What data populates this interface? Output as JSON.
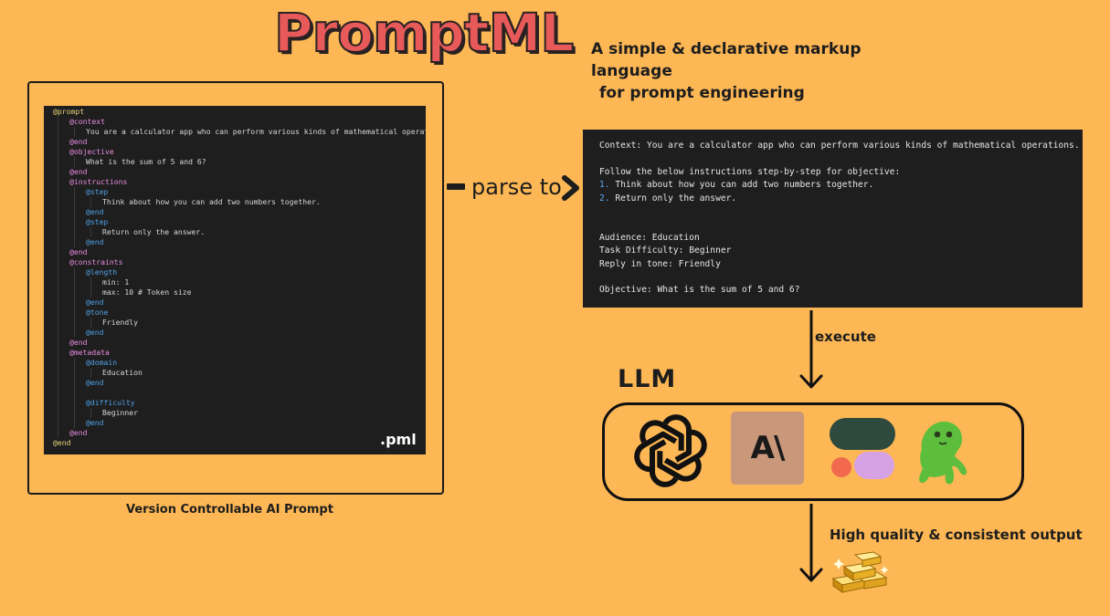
{
  "header": {
    "title": "PromptML",
    "subtitle_line1": "A simple & declarative  markup language",
    "subtitle_line2": "for prompt engineering"
  },
  "pml_panel": {
    "extension": ".pml",
    "caption": "Version Controllable AI Prompt",
    "code_lines": [
      {
        "depth": 0,
        "text": "@prompt",
        "kind": "k0"
      },
      {
        "depth": 1,
        "text": "@context",
        "kind": "k1"
      },
      {
        "depth": 2,
        "text": "You are a calculator app who can perform various kinds of mathematical operations.",
        "kind": "txt"
      },
      {
        "depth": 1,
        "text": "@end",
        "kind": "k1"
      },
      {
        "depth": 1,
        "text": "@objective",
        "kind": "k1"
      },
      {
        "depth": 2,
        "text": "What is the sum of 5 and 6?",
        "kind": "txt"
      },
      {
        "depth": 1,
        "text": "@end",
        "kind": "k1"
      },
      {
        "depth": 1,
        "text": "@instructions",
        "kind": "k1"
      },
      {
        "depth": 2,
        "text": "@step",
        "kind": "k2"
      },
      {
        "depth": 3,
        "text": "Think about how you can add two numbers together.",
        "kind": "txt"
      },
      {
        "depth": 2,
        "text": "@end",
        "kind": "k2"
      },
      {
        "depth": 2,
        "text": "@step",
        "kind": "k2"
      },
      {
        "depth": 3,
        "text": "Return only the answer.",
        "kind": "txt"
      },
      {
        "depth": 2,
        "text": "@end",
        "kind": "k2"
      },
      {
        "depth": 1,
        "text": "@end",
        "kind": "k1"
      },
      {
        "depth": 1,
        "text": "@constraints",
        "kind": "k1"
      },
      {
        "depth": 2,
        "text": "@length",
        "kind": "k2"
      },
      {
        "depth": 3,
        "text": "min: 1",
        "kind": "txt"
      },
      {
        "depth": 3,
        "text": "max: 10 # Token size",
        "kind": "txt"
      },
      {
        "depth": 2,
        "text": "@end",
        "kind": "k2"
      },
      {
        "depth": 2,
        "text": "@tone",
        "kind": "k2"
      },
      {
        "depth": 3,
        "text": "Friendly",
        "kind": "txt"
      },
      {
        "depth": 2,
        "text": "@end",
        "kind": "k2"
      },
      {
        "depth": 1,
        "text": "@end",
        "kind": "k1"
      },
      {
        "depth": 1,
        "text": "@metadata",
        "kind": "k1"
      },
      {
        "depth": 2,
        "text": "@domain",
        "kind": "k2"
      },
      {
        "depth": 3,
        "text": "Education",
        "kind": "txt"
      },
      {
        "depth": 2,
        "text": "@end",
        "kind": "k2"
      },
      {
        "depth": 2,
        "text": "",
        "kind": "txt"
      },
      {
        "depth": 2,
        "text": "@difficulty",
        "kind": "k2"
      },
      {
        "depth": 3,
        "text": "Beginner",
        "kind": "txt"
      },
      {
        "depth": 2,
        "text": "@end",
        "kind": "k2"
      },
      {
        "depth": 1,
        "text": "@end",
        "kind": "k1"
      },
      {
        "depth": 0,
        "text": "@end",
        "kind": "k0"
      }
    ]
  },
  "parse_arrow": {
    "label": "parse to"
  },
  "output_panel": {
    "lines": [
      {
        "num": "",
        "text": "Context: You are a calculator app who can perform various kinds of mathematical operations."
      },
      {
        "num": "",
        "text": ""
      },
      {
        "num": "",
        "text": "Follow the below instructions step-by-step for objective:"
      },
      {
        "num": "1.",
        "text": " Think about how you can add two numbers together."
      },
      {
        "num": "2.",
        "text": " Return only the answer."
      },
      {
        "num": "",
        "text": ""
      },
      {
        "num": "",
        "text": ""
      },
      {
        "num": "",
        "text": "Audience: Education"
      },
      {
        "num": "",
        "text": "Task Difficulty: Beginner"
      },
      {
        "num": "",
        "text": "Reply in tone: Friendly"
      },
      {
        "num": "",
        "text": ""
      },
      {
        "num": "",
        "text": "Objective: What is the sum of 5 and 6?"
      }
    ]
  },
  "execute_arrow": {
    "label": "execute"
  },
  "llm": {
    "label": "LLM",
    "logos": [
      {
        "name": "openai-logo-icon"
      },
      {
        "name": "anthropic-logo-icon",
        "text": "A\\"
      },
      {
        "name": "google-llm-logo-icon"
      },
      {
        "name": "sloth-logo-icon"
      }
    ]
  },
  "output_arrow": {
    "label": "High quality & consistent output"
  },
  "colors": {
    "background": "#FDB754",
    "title_fill": "#E8595A",
    "code_bg": "#1E1E1E",
    "keyword_pink": "#E98BE0",
    "keyword_blue": "#4FA1E6",
    "keyword_yellow": "#E6D37A",
    "anthropic_tile": "#C9977A",
    "sloth_green": "#5CBE3C"
  }
}
